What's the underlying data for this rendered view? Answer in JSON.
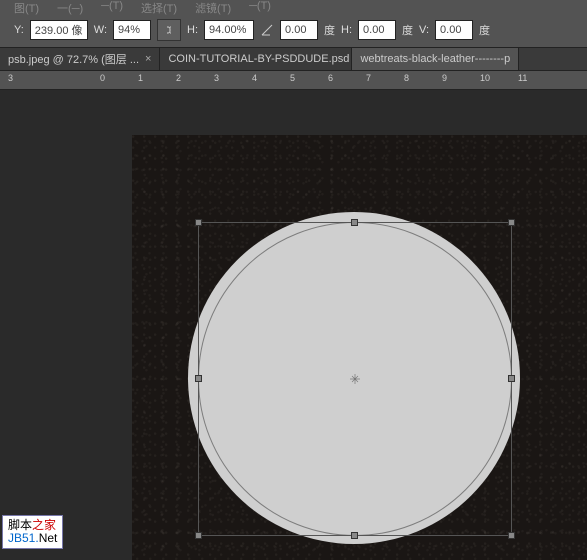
{
  "menubar": {
    "items": [
      "图(T)",
      "一(─)",
      "─(T)",
      "选择(T)",
      "滤镜(T)",
      "─(T)"
    ]
  },
  "options": {
    "y_label": "Y:",
    "y_value": "239.00 像",
    "w_label": "W:",
    "w_value": "94%",
    "h_label": "H:",
    "h_value": "94.00%",
    "angle_value": "0.00",
    "angle_unit": "度",
    "h2_label": "H:",
    "h2_value": "0.00",
    "h2_unit": "度",
    "v_label": "V:",
    "v_value": "0.00",
    "v_unit": "度"
  },
  "tabs": [
    {
      "label": "psb.jpeg @ 72.7% (图层 ...",
      "active": false
    },
    {
      "label": "COIN-TUTORIAL-BY-PSDDUDE.psd",
      "active": false
    },
    {
      "label": "webtreats-black-leather--------p",
      "active": true
    }
  ],
  "ruler": {
    "ticks": [
      "3",
      "0",
      "1",
      "2",
      "3",
      "4",
      "5",
      "6",
      "7",
      "8",
      "9",
      "10",
      "11"
    ]
  },
  "watermark": {
    "line1_a": "脚本",
    "line1_b": "之家",
    "line2_a": "JB51.",
    "line2_b": "Net"
  }
}
